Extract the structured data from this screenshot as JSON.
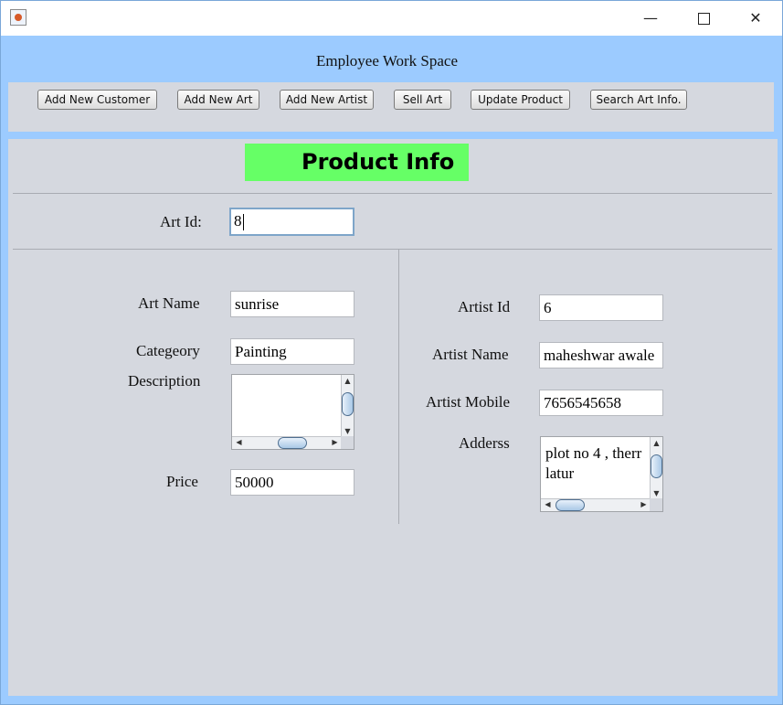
{
  "window": {
    "minimize_glyph": "—",
    "close_glyph": "✕"
  },
  "header": {
    "title": "Employee Work Space"
  },
  "toolbar": {
    "buttons": [
      "Add New Customer",
      "Add New Art",
      "Add New Artist",
      "Sell Art",
      "Update Product",
      "Search Art Info."
    ]
  },
  "product": {
    "heading": "Product Info",
    "art_id_label": "Art Id:",
    "art_id_value": "8",
    "art_name_label": "Art Name",
    "art_name_value": "sunrise",
    "category_label": "Categeory",
    "category_value": "Painting",
    "description_label": "Description",
    "description_value": "",
    "price_label": "Price",
    "price_value": "50000"
  },
  "artist": {
    "id_label": "Artist Id",
    "id_value": "6",
    "name_label": "Artist Name",
    "name_value": "maheshwar awale",
    "mobile_label": "Artist Mobile",
    "mobile_value": "7656545658",
    "address_label": "Adderss",
    "address_value": "plot no 4 , therr\nlatur"
  },
  "scroll_arrows": {
    "up": "▲",
    "down": "▼",
    "left": "◀",
    "right": "▶"
  }
}
